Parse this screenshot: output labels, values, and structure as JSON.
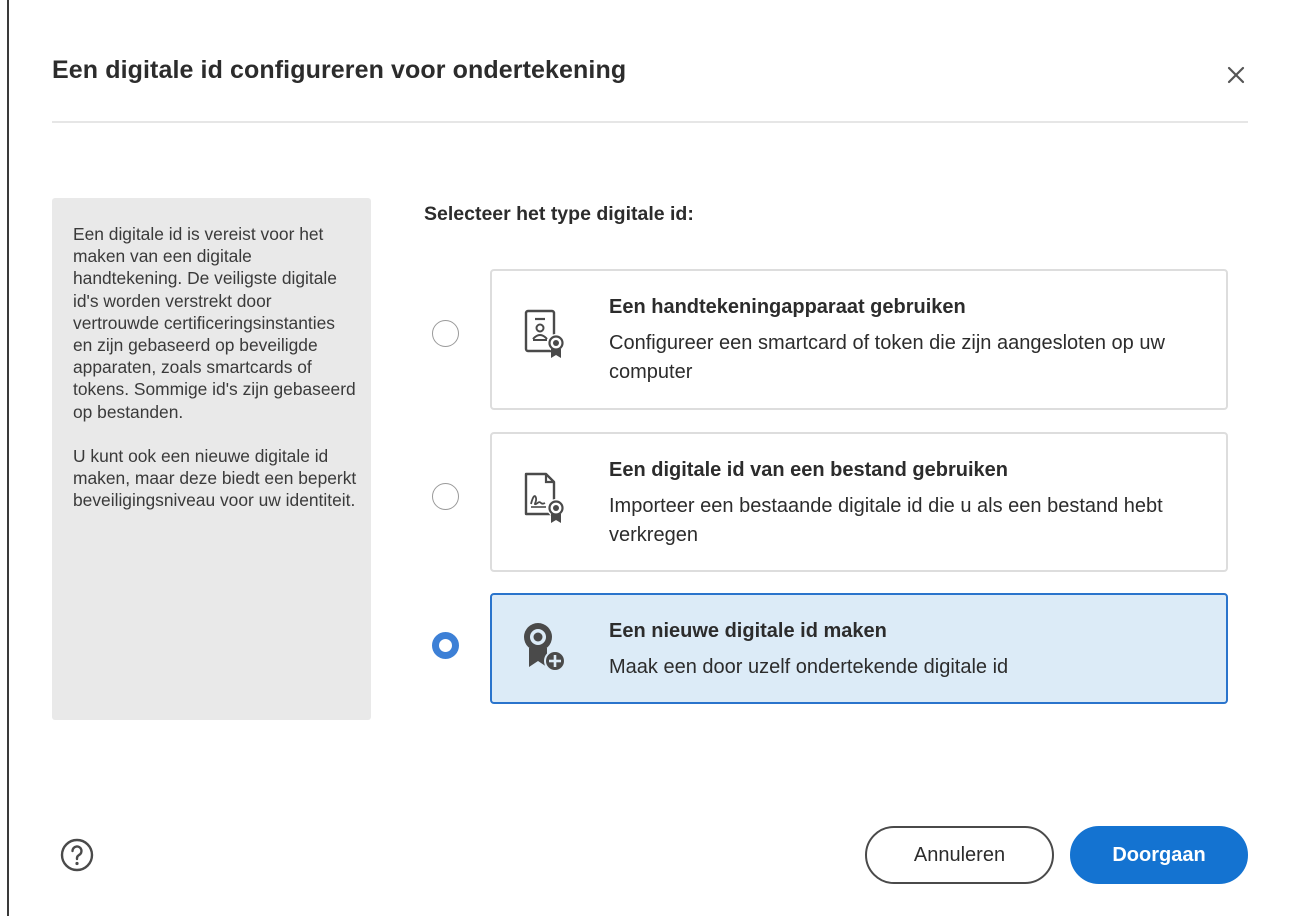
{
  "dialog": {
    "title": "Een digitale id configureren voor ondertekening",
    "close_icon": "close-icon"
  },
  "info": {
    "paragraph1": "Een digitale id is vereist voor het maken van een digitale handtekening. De veiligste digitale id's worden verstrekt door vertrouwde certificeringsinstanties en zijn gebaseerd op beveiligde apparaten, zoals smartcards of tokens. Sommige id's zijn gebaseerd op bestanden.",
    "paragraph2": "U kunt ook een nieuwe digitale id maken, maar deze biedt een beperkt beveiligingsniveau voor uw identiteit."
  },
  "selection": {
    "heading": "Selecteer het type digitale id:",
    "options": [
      {
        "title": "Een handtekeningapparaat gebruiken",
        "description": "Configureer een smartcard of token die zijn aangesloten op uw computer",
        "icon": "signature-device-icon",
        "selected": false
      },
      {
        "title": "Een digitale id van een bestand gebruiken",
        "description": "Importeer een bestaande digitale id die u als een bestand hebt verkregen",
        "icon": "certificate-file-icon",
        "selected": false
      },
      {
        "title": "Een nieuwe digitale id maken",
        "description": "Maak een door uzelf ondertekende digitale id",
        "icon": "new-certificate-icon",
        "selected": true
      }
    ]
  },
  "footer": {
    "help_icon": "help-icon",
    "cancel_label": "Annuleren",
    "continue_label": "Doorgaan"
  },
  "colors": {
    "accent": "#1473d1",
    "selected_background": "#dcebf7",
    "radio_checked": "#3d80d6",
    "info_panel_background": "#e9e9e9"
  }
}
